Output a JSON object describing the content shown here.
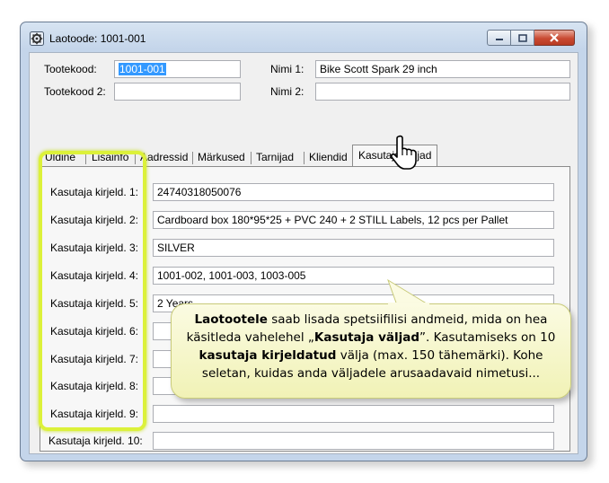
{
  "window": {
    "title": "Laotoode: 1001-001"
  },
  "header": {
    "tootekood_label": "Tootekood:",
    "tootekood_value": "1001-001",
    "tootekood2_label": "Tootekood 2:",
    "tootekood2_value": "",
    "nimi1_label": "Nimi 1:",
    "nimi1_value": "Bike Scott Spark 29 inch",
    "nimi2_label": "Nimi 2:",
    "nimi2_value": ""
  },
  "tabs": [
    {
      "label": "Üldine"
    },
    {
      "label": "Lisainfo"
    },
    {
      "label": "Aadressid"
    },
    {
      "label": "Märkused"
    },
    {
      "label": "Tarnijad"
    },
    {
      "label": "Kliendid"
    },
    {
      "label": "Kasutaja väljad"
    }
  ],
  "fields": [
    {
      "label": "Kasutaja kirjeld. 1:",
      "value": "24740318050076"
    },
    {
      "label": "Kasutaja kirjeld. 2:",
      "value": "Cardboard box 180*95*25 + PVC 240 + 2 STILL Labels, 12 pcs per Pallet"
    },
    {
      "label": "Kasutaja kirjeld. 3:",
      "value": "SILVER"
    },
    {
      "label": "Kasutaja kirjeld. 4:",
      "value": "1001-002, 1001-003, 1003-005"
    },
    {
      "label": "Kasutaja kirjeld. 5:",
      "value": "2 Years"
    },
    {
      "label": "Kasutaja kirjeld. 6:",
      "value": ""
    },
    {
      "label": "Kasutaja kirjeld. 7:",
      "value": ""
    },
    {
      "label": "Kasutaja kirjeld. 8:",
      "value": ""
    },
    {
      "label": "Kasutaja kirjeld. 9:",
      "value": ""
    },
    {
      "label": "Kasutaja kirjeld. 10:",
      "value": ""
    }
  ],
  "callout": {
    "b1": "Laotootele",
    "t1": " saab lisada spetsiifilisi andmeid, mida on hea käsitleda vahelehel „",
    "b2": "Kasutaja väljad",
    "t2": "”. Kasutamiseks on 10 ",
    "b3": "kasutaja kirjeldatud",
    "t3": " välja (max. 150 tähemärki).  Kohe seletan, kuidas anda väljadele arusaadavaid nimetusi..."
  },
  "colors": {
    "highlight": "#dcf13a",
    "callout_bg": "#f3f4bd",
    "selection": "#3399ff",
    "close_button": "#c94a32"
  },
  "icons": {
    "app": "gear-icon",
    "cursor": "hand-pointer-icon"
  }
}
